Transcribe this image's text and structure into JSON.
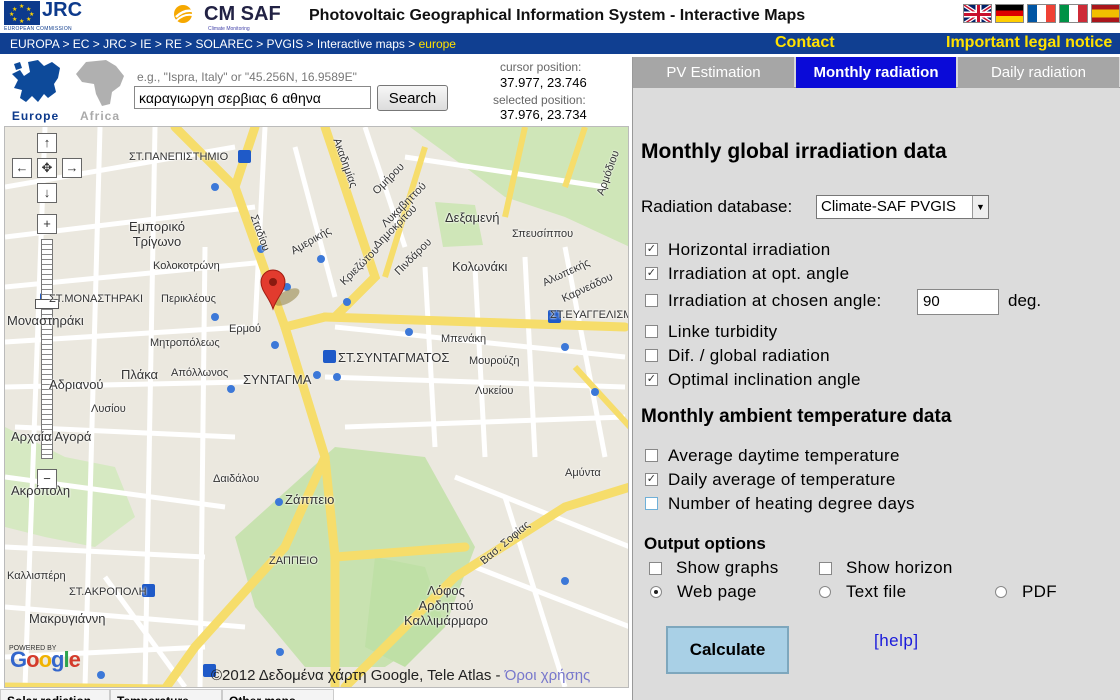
{
  "header": {
    "jrc": "JRC",
    "jrc_sub": "EUROPEAN COMMISSION",
    "cmsaf": "CM SAF",
    "cmsaf_sub": "Climate Monitoring",
    "title": "Photovoltaic Geographical Information System - Interactive Maps",
    "languages": [
      "uk-flag-icon",
      "de-flag-icon",
      "fr-flag-icon",
      "it-flag-icon",
      "es-flag-icon"
    ]
  },
  "nav": {
    "breadcrumb": "EUROPA > EC > JRC > IE > RE > SOLAREC > PVGIS > Interactive maps > ",
    "breadcrumb_current": "europe",
    "contact": "Contact",
    "legal": "Important legal notice"
  },
  "regions": {
    "europe": "Europe",
    "africa": "Africa"
  },
  "search": {
    "hint": "e.g., \"Ispra, Italy\" or \"45.256N, 16.9589E\"",
    "value": "καραγιωργη σερβιας 6 αθηνα",
    "button": "Search"
  },
  "position": {
    "cursor_label": "cursor position:",
    "cursor_value": "37.977, 23.746",
    "selected_label": "selected position:",
    "selected_value": "37.976, 23.734"
  },
  "map": {
    "labels": [
      "ΣΤ.ΠΑΝΕΠΙΣΤΗΜΙΟ",
      "Ομήρου",
      "Λυκαβηττού",
      "Δημοκρίτου",
      "Δεξαμενή",
      "Σπευσίππου",
      "Εμπορικό Τρίγωνο",
      "Κολοκοτρώνη",
      "Αμερικής",
      "Κριεζώτου",
      "Πινδάρου",
      "Κολωνάκι",
      "Αλωπεκής",
      "Καρνεάδου",
      "ΣΤ.ΜΟΝΑΣΤΗΡΑΚΙ",
      "Περικλέους",
      "Ερμού",
      "ΣΤ.ΕΥΑΓΓΕΛΙΣΜΟΣ",
      "Μοναστηράκι",
      "Μητροπόλεως",
      "Μπενάκη",
      "ΣΤ.ΣΥΝΤΑΓΜΑΤΟΣ",
      "Μουρούζη",
      "ΣΥΝΤΑΓΜΑ",
      "Πλάκα",
      "Απόλλωνος",
      "Λυκείου",
      "Αδριανού",
      "Λυσίου",
      "Αρχαία Αγορά",
      "Δαιδάλου",
      "Ακρόπολη",
      "Ζάππειο",
      "ΖΑΠΠΕΙΟ",
      "Καλλισπέρη",
      "ΣΤ.ΑΚΡΟΠΟΛΗ",
      "Λόφος Αρδηττού Καλλιμάρμαρο",
      "Μακρυγιάννη",
      "Σταδίου",
      "Ακαδημίας",
      "Αρμόδιου",
      "Αμύντα",
      "Βασ. Σοφίας"
    ],
    "copyright": "©2012 Δεδομένα χάρτη Google, Tele Atlas - ",
    "terms": "Όροι χρήσης",
    "powered_by": "POWERED BY",
    "google": "Google"
  },
  "bottom_tabs": [
    "Solar radiation",
    "Temperature",
    "Other maps"
  ],
  "panel": {
    "tabs": [
      "PV Estimation",
      "Monthly radiation",
      "Daily radiation"
    ],
    "active_tab": "Monthly radiation",
    "title": "Monthly global irradiation data",
    "radiation_db_label": "Radiation database:",
    "radiation_db_value": "Climate-SAF PVGIS",
    "options": [
      {
        "label": "Horizontal irradiation",
        "checked": true
      },
      {
        "label": "Irradiation at opt. angle",
        "checked": true
      },
      {
        "label": "Irradiation at chosen angle:",
        "checked": false
      },
      {
        "label": "Linke turbidity",
        "checked": false
      },
      {
        "label": "Dif. / global radiation",
        "checked": false
      },
      {
        "label": "Optimal inclination angle",
        "checked": true
      }
    ],
    "chosen_angle": "90",
    "angle_unit": "deg.",
    "temp_title": "Monthly ambient temperature data",
    "temp_options": [
      {
        "label": "Average daytime temperature",
        "checked": false
      },
      {
        "label": "Daily average of temperature",
        "checked": true
      },
      {
        "label": "Number of heating degree days",
        "checked": false
      }
    ],
    "output_title": "Output options",
    "show_graphs": "Show graphs",
    "show_horizon": "Show horizon",
    "formats": [
      "Web page",
      "Text file",
      "PDF"
    ],
    "selected_format": "Web page",
    "calculate": "Calculate",
    "help": "[help]"
  }
}
